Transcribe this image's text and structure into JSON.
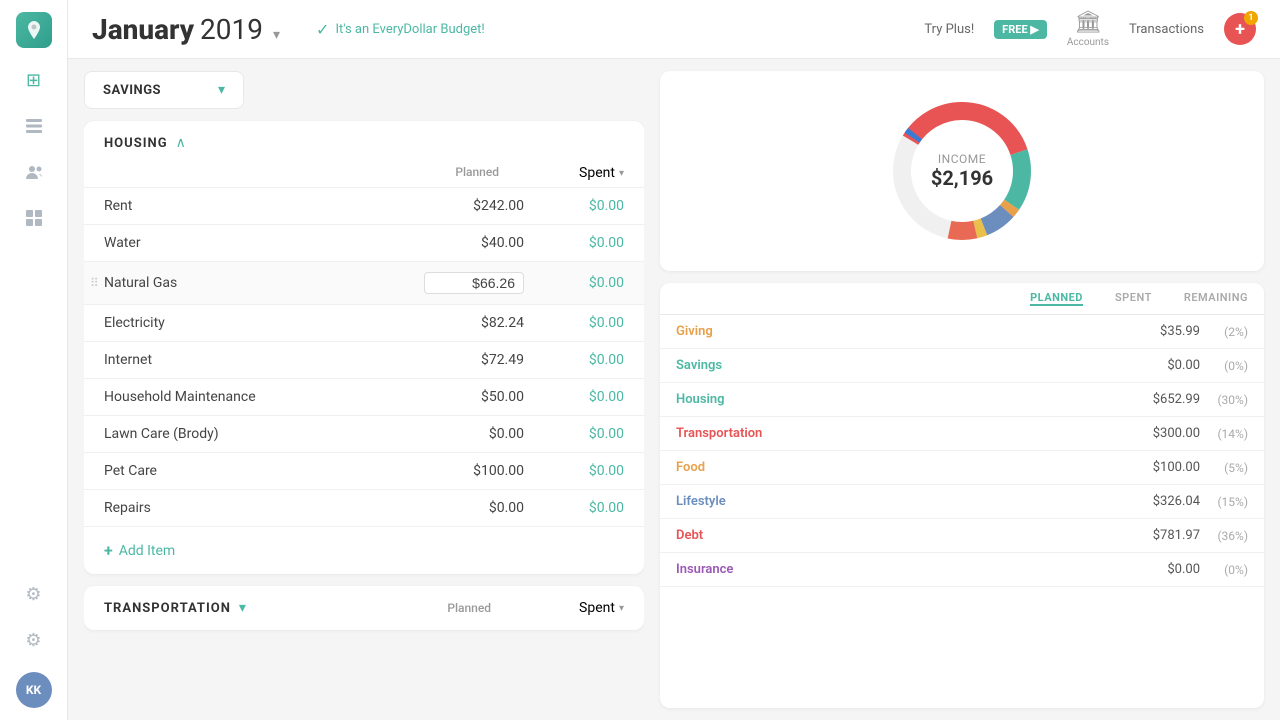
{
  "sidebar": {
    "logo_text": "🌿",
    "avatar_text": "KK",
    "icons": [
      {
        "name": "dashboard-icon",
        "symbol": "⊞"
      },
      {
        "name": "layers-icon",
        "symbol": "◫"
      },
      {
        "name": "users-icon",
        "symbol": "👤"
      },
      {
        "name": "play-icon",
        "symbol": "▷"
      },
      {
        "name": "settings-icon",
        "symbol": "⚙"
      },
      {
        "name": "gear-icon",
        "symbol": "⚙"
      }
    ]
  },
  "topbar": {
    "month": "January",
    "year": "2019",
    "everydollar_text": "It's an EveryDollar Budget!",
    "try_plus_label": "FREE ▶",
    "accounts_label": "Accounts",
    "transactions_label": "Transactions"
  },
  "savings": {
    "label": "SAVINGS"
  },
  "housing": {
    "title": "HOUSING",
    "planned_col": "Planned",
    "spent_col": "Spent",
    "items": [
      {
        "name": "Rent",
        "planned": "$242.00",
        "spent": "$0.00"
      },
      {
        "name": "Water",
        "planned": "$40.00",
        "spent": "$0.00"
      },
      {
        "name": "Natural Gas",
        "planned": "$66.26",
        "spent": "$0.00",
        "editing": true
      },
      {
        "name": "Electricity",
        "planned": "$82.24",
        "spent": "$0.00"
      },
      {
        "name": "Internet",
        "planned": "$72.49",
        "spent": "$0.00"
      },
      {
        "name": "Household Maintenance",
        "planned": "$50.00",
        "spent": "$0.00"
      },
      {
        "name": "Lawn Care (Brody)",
        "planned": "$0.00",
        "spent": "$0.00"
      },
      {
        "name": "Pet Care",
        "planned": "$100.00",
        "spent": "$0.00"
      },
      {
        "name": "Repairs",
        "planned": "$0.00",
        "spent": "$0.00"
      }
    ],
    "add_item_label": "Add Item"
  },
  "transportation": {
    "title": "TRANSPORTATION",
    "planned_col": "Planned",
    "spent_col": "Spent"
  },
  "donut": {
    "label": "INCOME",
    "amount": "$2,196"
  },
  "summary": {
    "col_planned": "PLANNED",
    "col_spent": "SPENT",
    "col_remaining": "REMAINING",
    "rows": [
      {
        "category": "Giving",
        "color": "cat-giving",
        "planned": "$35.99",
        "pct": "(2%)"
      },
      {
        "category": "Savings",
        "color": "cat-savings",
        "planned": "$0.00",
        "pct": "(0%)"
      },
      {
        "category": "Housing",
        "color": "cat-housing",
        "planned": "$652.99",
        "pct": "(30%)"
      },
      {
        "category": "Transportation",
        "color": "cat-transportation",
        "planned": "$300.00",
        "pct": "(14%)"
      },
      {
        "category": "Food",
        "color": "cat-food",
        "planned": "$100.00",
        "pct": "(5%)"
      },
      {
        "category": "Lifestyle",
        "color": "cat-lifestyle",
        "planned": "$326.04",
        "pct": "(15%)"
      },
      {
        "category": "Debt",
        "color": "cat-debt",
        "planned": "$781.97",
        "pct": "(36%)"
      },
      {
        "category": "Insurance",
        "color": "cat-insurance",
        "planned": "$0.00",
        "pct": "(0%)"
      }
    ]
  }
}
